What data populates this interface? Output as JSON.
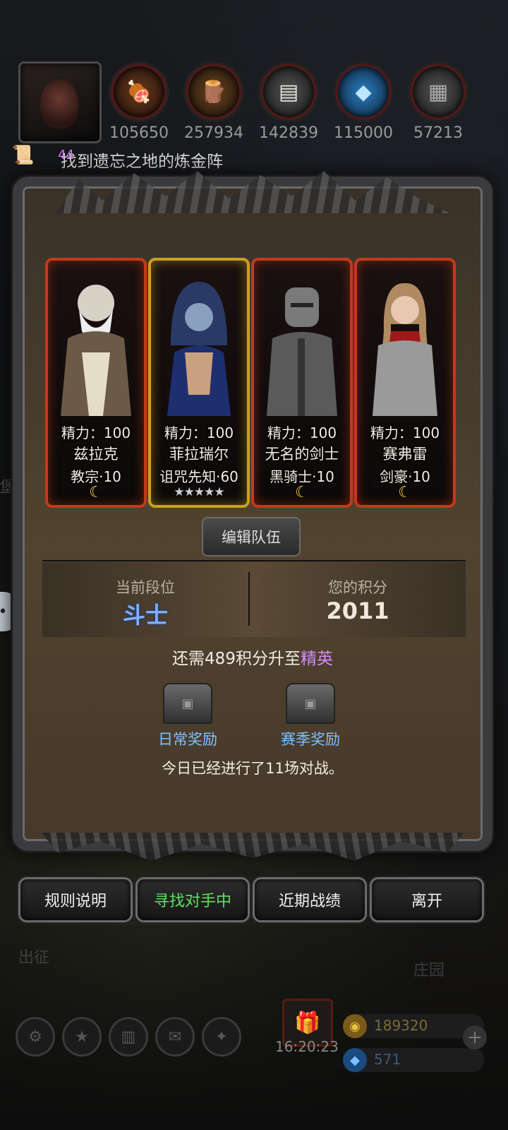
{
  "top": {
    "resources": [
      {
        "icon": "meat-icon",
        "value": "105650",
        "color": "#b5632a"
      },
      {
        "icon": "wood-icon",
        "value": "257934",
        "color": "#a66a30"
      },
      {
        "icon": "iron-icon",
        "value": "142839",
        "color": "#888888"
      },
      {
        "icon": "crystal-icon",
        "value": "115000",
        "color": "#3aa6e8"
      },
      {
        "icon": "stone-icon",
        "value": "57213",
        "color": "#8a8a8a"
      }
    ],
    "quest": {
      "level": "44",
      "text": "找到遗忘之地的炼金阵"
    }
  },
  "background_labels": {
    "left": "堡",
    "left_bottom": "出征",
    "right_bottom": "庄园"
  },
  "heroes": [
    {
      "stamina": "精力：100",
      "name": "兹拉克",
      "class": "教宗·10",
      "frame": "red",
      "badge": "moon"
    },
    {
      "stamina": "精力：100",
      "name": "菲拉瑞尔",
      "class": "诅咒先知·60",
      "frame": "gold",
      "badge": "★★★★★"
    },
    {
      "stamina": "精力：100",
      "name": "无名的剑士",
      "class": "黑骑士·10",
      "frame": "red",
      "badge": "moon"
    },
    {
      "stamina": "精力：100",
      "name": "赛弗雷",
      "class": "剑豪·10",
      "frame": "red",
      "badge": "moon"
    }
  ],
  "panel": {
    "edit_team": "编辑队伍",
    "rank_label": "当前段位",
    "rank_value": "斗士",
    "score_label": "您的积分",
    "score_value": "2011",
    "need_prefix": "还需489积分升至",
    "need_target": "精英",
    "daily_reward": "日常奖励",
    "season_reward": "赛季奖励",
    "battles_today": "今日已经进行了11场对战。"
  },
  "buttons": {
    "rules": "规则说明",
    "searching": "寻找对手中",
    "records": "近期战绩",
    "leave": "离开"
  },
  "footer": {
    "time": "16:20:23",
    "gold": "189320",
    "gems": "571"
  },
  "colors": {
    "accent_green": "#5fe05f",
    "elite_purple": "#d58cff",
    "rank_blue": "#7fb0ff",
    "reward_blue": "#7fc0ff"
  }
}
